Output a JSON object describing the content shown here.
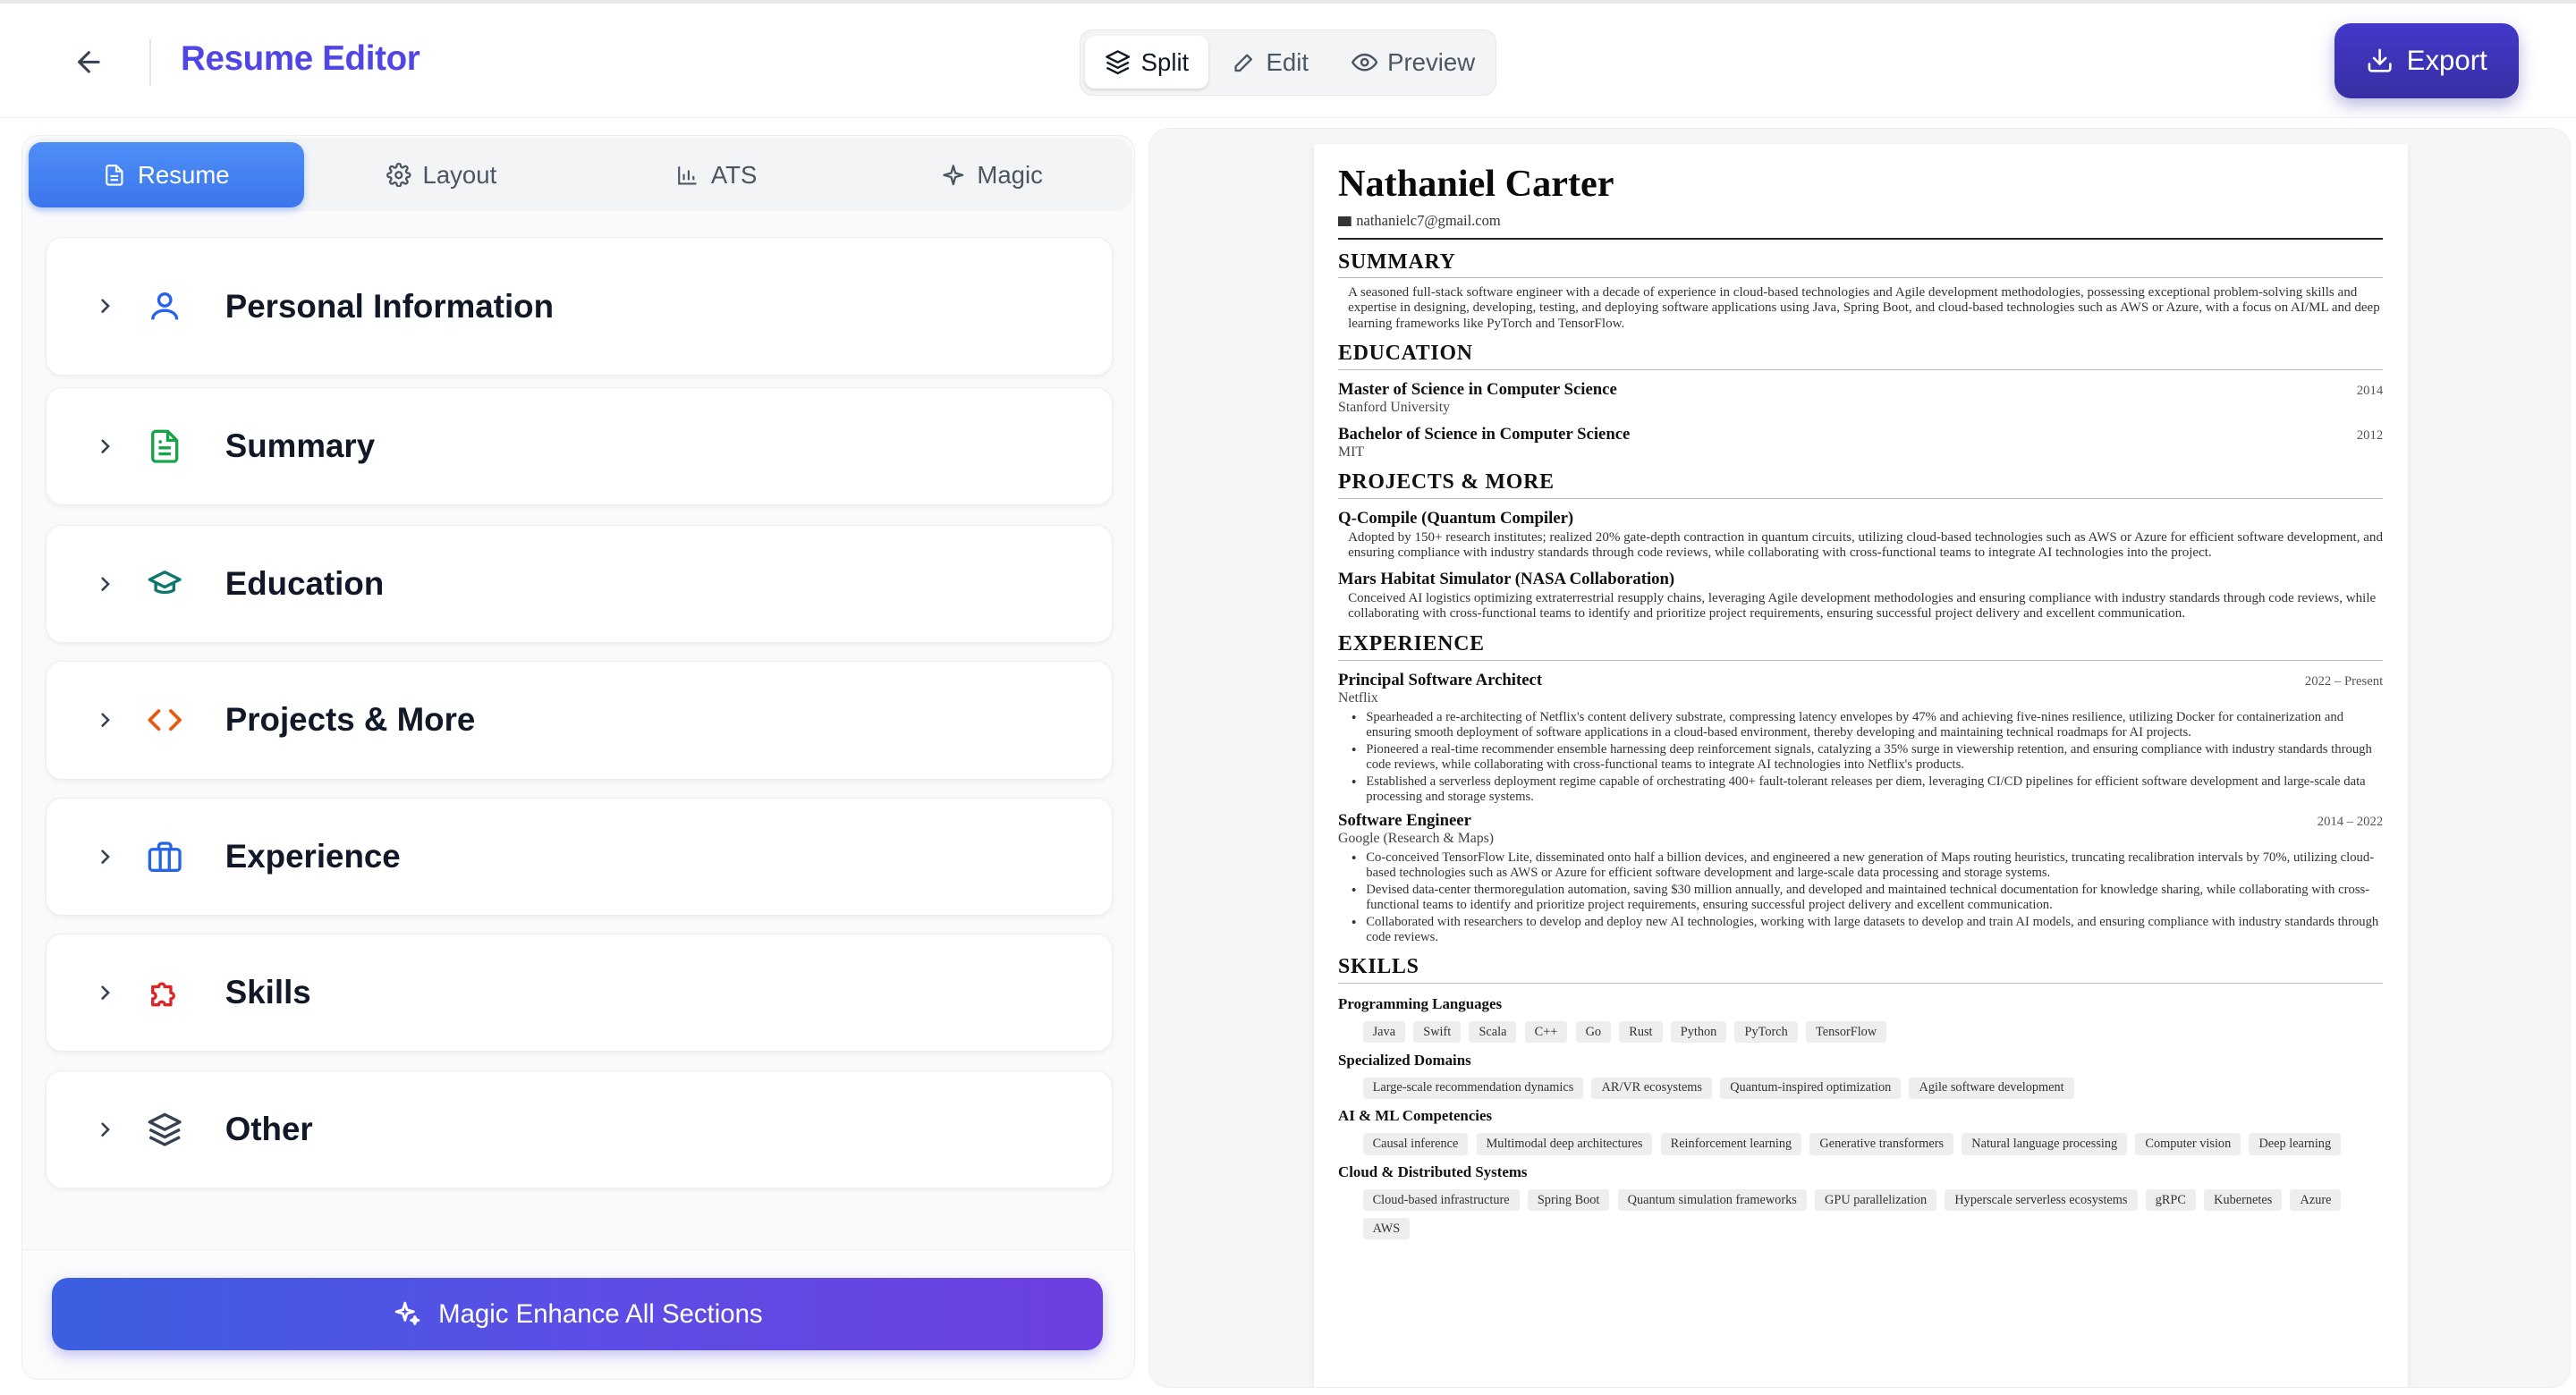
{
  "header": {
    "title": "Resume Editor",
    "view_modes": [
      {
        "label": "Split",
        "icon": "layers-icon",
        "active": true
      },
      {
        "label": "Edit",
        "icon": "pencil-icon",
        "active": false
      },
      {
        "label": "Preview",
        "icon": "eye-icon",
        "active": false
      }
    ],
    "export_label": "Export"
  },
  "tabs": [
    {
      "label": "Resume",
      "icon": "document-icon",
      "active": true
    },
    {
      "label": "Layout",
      "icon": "gear-icon",
      "active": false
    },
    {
      "label": "ATS",
      "icon": "bar-chart-icon",
      "active": false
    },
    {
      "label": "Magic",
      "icon": "sparkle-icon",
      "active": false
    }
  ],
  "sections": [
    {
      "label": "Personal Information",
      "icon": "user-icon",
      "color": "#2563eb"
    },
    {
      "label": "Summary",
      "icon": "file-text-icon",
      "color": "#16a34a"
    },
    {
      "label": "Education",
      "icon": "graduation-cap-icon",
      "color": "#0f766e"
    },
    {
      "label": "Projects & More",
      "icon": "code-icon",
      "color": "#ea580c"
    },
    {
      "label": "Experience",
      "icon": "briefcase-icon",
      "color": "#2563eb"
    },
    {
      "label": "Skills",
      "icon": "puzzle-icon",
      "color": "#dc2626"
    },
    {
      "label": "Other",
      "icon": "layers-icon",
      "color": "#374151"
    }
  ],
  "magic_button_label": "Magic Enhance All Sections",
  "resume": {
    "name": "Nathaniel Carter",
    "email": "nathanielc7@gmail.com",
    "summary_heading": "SUMMARY",
    "summary": "A seasoned full-stack software engineer with a decade of experience in cloud-based technologies and Agile development methodologies, possessing exceptional problem-solving skills and expertise in designing, developing, testing, and deploying software applications using Java, Spring Boot, and cloud-based technologies such as AWS or Azure, with a focus on AI/ML and deep learning frameworks like PyTorch and TensorFlow.",
    "education_heading": "EDUCATION",
    "education": [
      {
        "degree": "Master of Science in Computer Science",
        "school": "Stanford University",
        "year": "2014"
      },
      {
        "degree": "Bachelor of Science in Computer Science",
        "school": "MIT",
        "year": "2012"
      }
    ],
    "projects_heading": "PROJECTS & MORE",
    "projects": [
      {
        "title": "Q-Compile (Quantum Compiler)",
        "desc": "Adopted by 150+ research institutes; realized 20% gate-depth contraction in quantum circuits, utilizing cloud-based technologies such as AWS or Azure for efficient software development, and ensuring compliance with industry standards through code reviews, while collaborating with cross-functional teams to integrate AI technologies into the project."
      },
      {
        "title": "Mars Habitat Simulator (NASA Collaboration)",
        "desc": "Conceived AI logistics optimizing extraterrestrial resupply chains, leveraging Agile development methodologies and ensuring compliance with industry standards through code reviews, while collaborating with cross-functional teams to identify and prioritize project requirements, ensuring successful project delivery and excellent communication."
      }
    ],
    "experience_heading": "EXPERIENCE",
    "experience": [
      {
        "title": "Principal Software Architect",
        "company": "Netflix",
        "dates": "2022 – Present",
        "bullets": [
          "Spearheaded a re-architecting of Netflix's content delivery substrate, compressing latency envelopes by 47% and achieving five-nines resilience, utilizing Docker for containerization and ensuring smooth deployment of software applications in a cloud-based environment, thereby developing and maintaining technical roadmaps for AI projects.",
          "Pioneered a real-time recommender ensemble harnessing deep reinforcement signals, catalyzing a 35% surge in viewership retention, and ensuring compliance with industry standards through code reviews, while collaborating with cross-functional teams to integrate AI technologies into Netflix's products.",
          "Established a serverless deployment regime capable of orchestrating 400+ fault-tolerant releases per diem, leveraging CI/CD pipelines for efficient software development and large-scale data processing and storage systems."
        ]
      },
      {
        "title": "Software Engineer",
        "company": "Google (Research & Maps)",
        "dates": "2014 – 2022",
        "bullets": [
          "Co-conceived TensorFlow Lite, disseminated onto half a billion devices, and engineered a new generation of Maps routing heuristics, truncating recalibration intervals by 70%, utilizing cloud-based technologies such as AWS or Azure for efficient software development and large-scale data processing and storage systems.",
          "Devised data-center thermoregulation automation, saving $30 million annually, and developed and maintained technical documentation for knowledge sharing, while collaborating with cross-functional teams to identify and prioritize project requirements, ensuring successful project delivery and excellent communication.",
          "Collaborated with researchers to develop and deploy new AI technologies, working with large datasets to develop and train AI models, and ensuring compliance with industry standards through code reviews."
        ]
      }
    ],
    "skills_heading": "SKILLS",
    "skills": [
      {
        "category": "Programming Languages",
        "items": [
          "Java",
          "Swift",
          "Scala",
          "C++",
          "Go",
          "Rust",
          "Python",
          "PyTorch",
          "TensorFlow"
        ]
      },
      {
        "category": "Specialized Domains",
        "items": [
          "Large-scale recommendation dynamics",
          "AR/VR ecosystems",
          "Quantum-inspired optimization",
          "Agile software development"
        ]
      },
      {
        "category": "AI & ML Competencies",
        "items": [
          "Causal inference",
          "Multimodal deep architectures",
          "Reinforcement learning",
          "Generative transformers",
          "Natural language processing",
          "Computer vision",
          "Deep learning"
        ]
      },
      {
        "category": "Cloud & Distributed Systems",
        "items": [
          "Cloud-based infrastructure",
          "Spring Boot",
          "Quantum simulation frameworks",
          "GPU parallelization",
          "Hyperscale serverless ecosystems",
          "gRPC",
          "Kubernetes",
          "Azure",
          "AWS"
        ]
      }
    ]
  }
}
